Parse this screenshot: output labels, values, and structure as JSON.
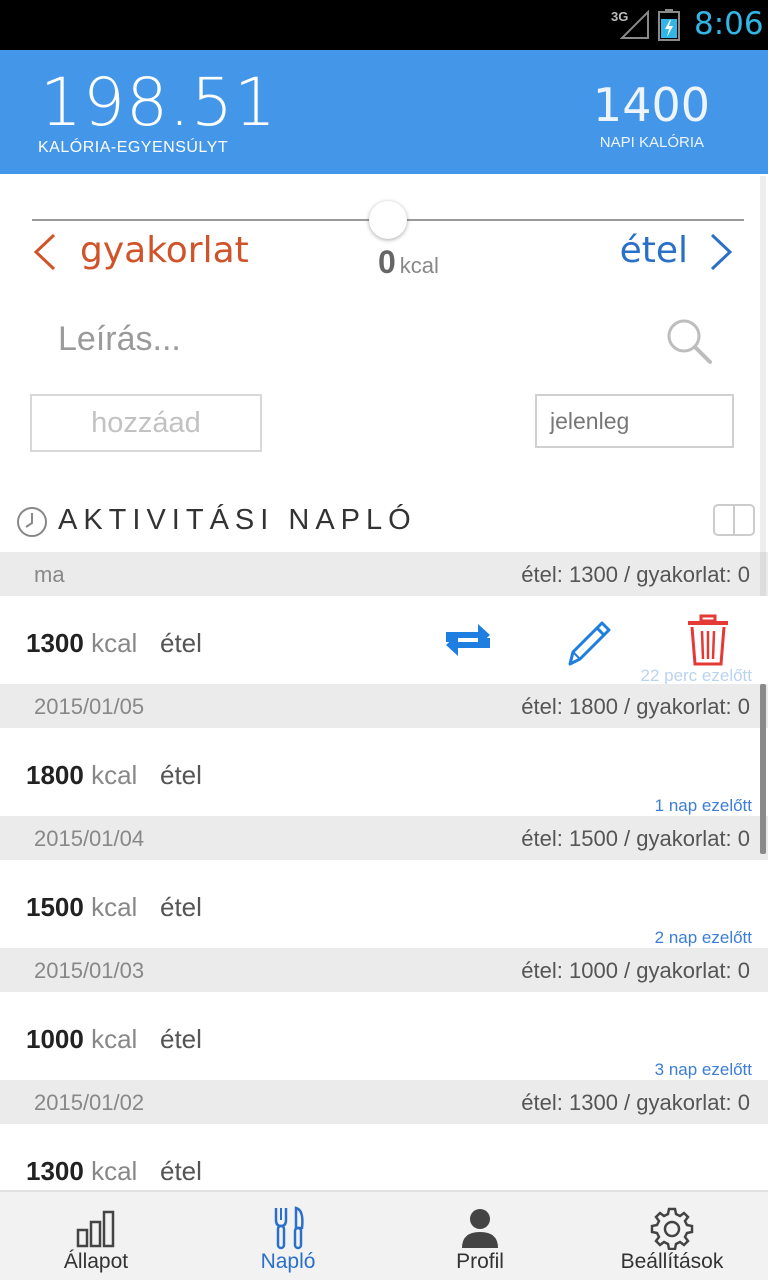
{
  "status_bar": {
    "network": "3G",
    "time": "8:06"
  },
  "header": {
    "balance_value": "198.51",
    "balance_label": "KALÓRIA-EGYENSÚLYT",
    "daily_value": "1400",
    "daily_label": "NAPI KALÓRIA"
  },
  "slider": {
    "value": 0
  },
  "modes": {
    "left": "gyakorlat",
    "right": "étel"
  },
  "kcal": {
    "value": "0",
    "unit": "kcal"
  },
  "search": {
    "placeholder": "Leírás..."
  },
  "add_button": "hozzáad",
  "time_field": "jelenleg",
  "log": {
    "title": "AKTIVITÁSI NAPLÓ",
    "days": [
      {
        "date": "ma",
        "summary": "étel: 1300 / gyakorlat: 0",
        "entry": {
          "amount": "1300",
          "unit": "kcal",
          "type": "étel",
          "ago": "22 perc ezelőtt"
        }
      },
      {
        "date": "2015/01/05",
        "summary": "étel: 1800 / gyakorlat: 0",
        "entry": {
          "amount": "1800",
          "unit": "kcal",
          "type": "étel",
          "ago": "1 nap ezelőtt"
        }
      },
      {
        "date": "2015/01/04",
        "summary": "étel: 1500 / gyakorlat: 0",
        "entry": {
          "amount": "1500",
          "unit": "kcal",
          "type": "étel",
          "ago": "2 nap ezelőtt"
        }
      },
      {
        "date": "2015/01/03",
        "summary": "étel: 1000 / gyakorlat: 0",
        "entry": {
          "amount": "1000",
          "unit": "kcal",
          "type": "étel",
          "ago": "3 nap ezelőtt"
        }
      },
      {
        "date": "2015/01/02",
        "summary": "étel: 1300 / gyakorlat: 0",
        "entry": {
          "amount": "1300",
          "unit": "kcal",
          "type": "étel",
          "ago": ""
        }
      }
    ]
  },
  "icons": {
    "repeat": "repeat-icon",
    "edit": "pencil-icon",
    "delete": "trash-icon",
    "search": "search-icon",
    "clock": "clock-icon",
    "book": "book-icon"
  },
  "nav": [
    {
      "label": "Állapot",
      "icon": "bar-chart-icon",
      "active": false
    },
    {
      "label": "Napló",
      "icon": "fork-knife-icon",
      "active": true
    },
    {
      "label": "Profil",
      "icon": "person-icon",
      "active": false
    },
    {
      "label": "Beállítások",
      "icon": "gear-icon",
      "active": false
    }
  ],
  "colors": {
    "header_bg": "#4396e8",
    "exercise": "#d0532a",
    "food": "#2a6fc8",
    "delete": "#e53935",
    "action_blue": "#1e7fe0"
  }
}
